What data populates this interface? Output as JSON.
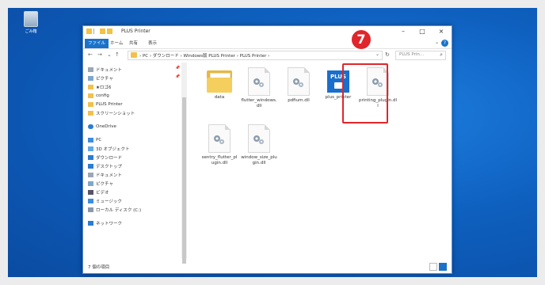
{
  "desktop": {
    "icon_label": "ごみ箱"
  },
  "window": {
    "title": "PLUS Printer",
    "controls": {
      "minimize": "–",
      "maximize": "□",
      "close": "×"
    }
  },
  "ribbon": {
    "tabs": [
      "ファイル",
      "ホーム",
      "共有",
      "表示"
    ],
    "collapse": "⌄",
    "help": "?"
  },
  "address": {
    "back": "←",
    "forward": "→",
    "recent": "⌄",
    "up": "↑",
    "path": "› PC › ダウンロード › Windows版 PLUS Printer › PLUS Printer ›",
    "dropdown": "⌄",
    "refresh": "↻",
    "search_placeholder": "PLUS Prin...",
    "search_icon": "⌕"
  },
  "nav_pane": {
    "items": [
      {
        "label": "ドキュメント",
        "icon": "document-icon",
        "pinned": true
      },
      {
        "label": "ピクチャ",
        "icon": "pictures-icon",
        "pinned": true
      },
      {
        "label": "★ロゴ6",
        "icon": "folder-icon",
        "pinned": false
      },
      {
        "label": "config",
        "icon": "folder-icon",
        "pinned": false
      },
      {
        "label": "PLUS Printer",
        "icon": "folder-icon",
        "pinned": false
      },
      {
        "label": "スクリーンショット",
        "icon": "folder-icon",
        "pinned": false
      },
      {
        "label": "OneDrive",
        "icon": "cloud-icon",
        "pinned": false
      },
      {
        "label": "PC",
        "icon": "pc-icon",
        "pinned": false
      },
      {
        "label": "3D オブジェクト",
        "icon": "3d-icon",
        "pinned": false
      },
      {
        "label": "ダウンロード",
        "icon": "download-icon",
        "pinned": false
      },
      {
        "label": "デスクトップ",
        "icon": "desktop-icon",
        "pinned": false
      },
      {
        "label": "ドキュメント",
        "icon": "document-icon",
        "pinned": false
      },
      {
        "label": "ピクチャ",
        "icon": "pictures-icon",
        "pinned": false
      },
      {
        "label": "ビデオ",
        "icon": "video-icon",
        "pinned": false
      },
      {
        "label": "ミュージック",
        "icon": "music-icon",
        "pinned": false
      },
      {
        "label": "ローカル ディスク (C:)",
        "icon": "disk-icon",
        "pinned": false
      },
      {
        "label": "ネットワーク",
        "icon": "network-icon",
        "pinned": false
      }
    ],
    "pin_glyph": "📌"
  },
  "files": [
    {
      "name": "data",
      "type": "folder"
    },
    {
      "name": "flutter_windows.dll",
      "type": "dll"
    },
    {
      "name": "pdfium.dll",
      "type": "dll"
    },
    {
      "name": "plus_printer",
      "type": "app",
      "app_label": "PLUS"
    },
    {
      "name": "printing_plugin.dll",
      "type": "dll"
    },
    {
      "name": "sentry_flutter_plugin.dll",
      "type": "dll"
    },
    {
      "name": "window_size_plugin.dll",
      "type": "dll"
    }
  ],
  "annotation": {
    "step": "7",
    "color": "#e0262b"
  },
  "status": {
    "item_count": "7 個の項目"
  },
  "colors": {
    "accent": "#1a73c9",
    "desktop": "#0e5fbe",
    "folder": "#f0c24d"
  }
}
